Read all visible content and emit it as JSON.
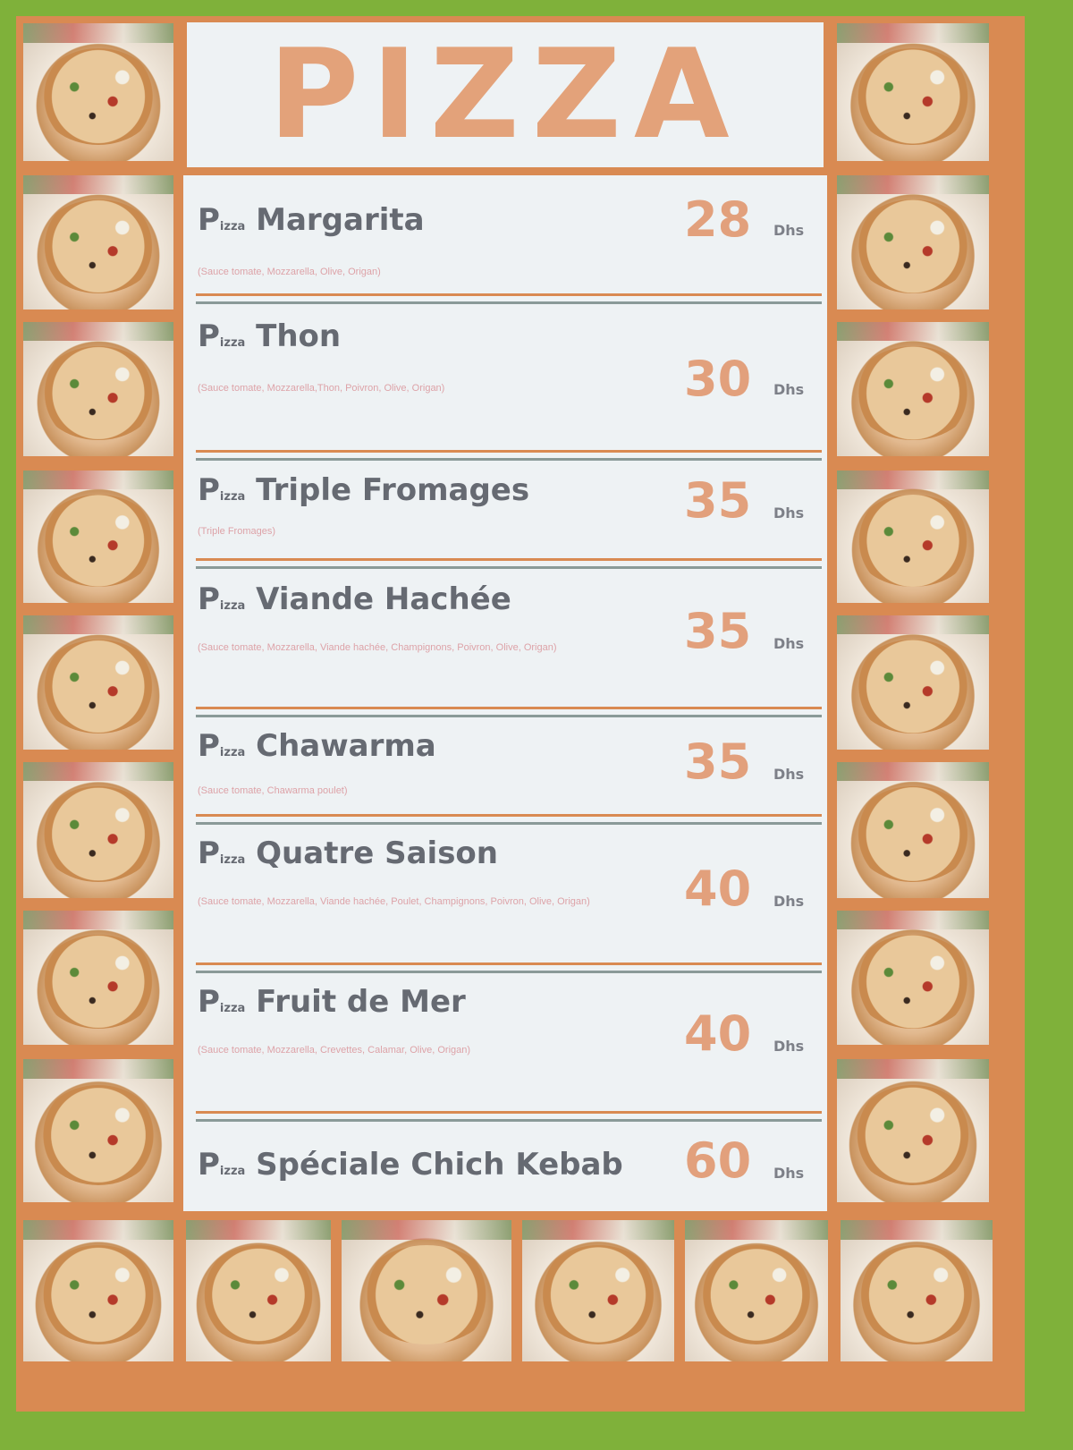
{
  "title": "PIZZA",
  "currency": "Dhs",
  "p_letter": "P",
  "izza": "izza",
  "items": [
    {
      "name": "Margarita",
      "desc": "(Sauce tomate, Mozzarella, Olive, Origan)",
      "price": "28"
    },
    {
      "name": "Thon",
      "desc": "(Sauce tomate, Mozzarella,Thon, Poivron, Olive, Origan)",
      "price": "30"
    },
    {
      "name": "Triple Fromages",
      "desc": "(Triple Fromages)",
      "price": "35"
    },
    {
      "name": "Viande Hachée",
      "desc": "(Sauce tomate, Mozzarella, Viande hachée, Champignons, Poivron, Olive, Origan)",
      "price": "35"
    },
    {
      "name": "Chawarma",
      "desc": "(Sauce tomate, Chawarma poulet)",
      "price": "35"
    },
    {
      "name": "Quatre Saison",
      "desc": "(Sauce tomate, Mozzarella, Viande hachée, Poulet, Champignons, Poivron, Olive, Origan)",
      "price": "40"
    },
    {
      "name": "Fruit de Mer",
      "desc": "(Sauce tomate, Mozzarella, Crevettes, Calamar, Olive, Origan)",
      "price": "40"
    },
    {
      "name": "Spéciale Chich Kebab",
      "desc": "",
      "price": "60"
    }
  ]
}
